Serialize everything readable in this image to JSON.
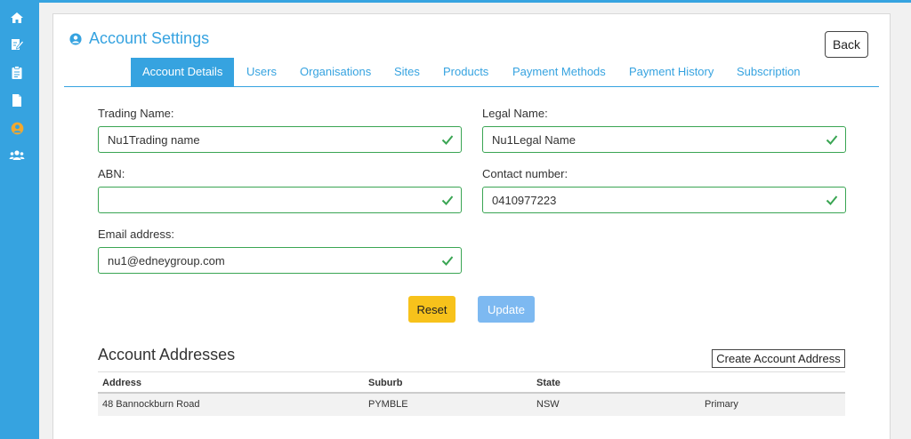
{
  "sidebar": {
    "items": [
      {
        "icon": "home-icon",
        "color": "#ffffff"
      },
      {
        "icon": "edit-document-icon",
        "color": "#ffffff"
      },
      {
        "icon": "clipboard-icon",
        "color": "#ffffff"
      },
      {
        "icon": "file-icon",
        "color": "#ffffff"
      },
      {
        "icon": "user-circle-icon",
        "color": "#f0a830",
        "active": true
      },
      {
        "icon": "users-icon",
        "color": "#ffffff"
      }
    ]
  },
  "header": {
    "title": "Account Settings",
    "back_label": "Back"
  },
  "tabs": [
    {
      "label": "Account Details",
      "active": true
    },
    {
      "label": "Users"
    },
    {
      "label": "Organisations"
    },
    {
      "label": "Sites"
    },
    {
      "label": "Products"
    },
    {
      "label": "Payment Methods"
    },
    {
      "label": "Payment History"
    },
    {
      "label": "Subscription"
    }
  ],
  "form": {
    "trading_name": {
      "label": "Trading Name:",
      "value": "Nu1Trading name"
    },
    "legal_name": {
      "label": "Legal Name:",
      "value": "Nu1Legal Name"
    },
    "abn": {
      "label": "ABN:",
      "value": ""
    },
    "contact_number": {
      "label": "Contact number:",
      "value": "0410977223"
    },
    "email": {
      "label": "Email address:",
      "value": "nu1@edneygroup.com"
    },
    "reset_label": "Reset",
    "update_label": "Update"
  },
  "addresses": {
    "title": "Account Addresses",
    "create_label": "Create Account Address",
    "columns": [
      "Address",
      "Suburb",
      "State",
      ""
    ],
    "rows": [
      [
        "48 Bannockburn Road",
        "PYMBLE",
        "NSW",
        "Primary"
      ]
    ]
  },
  "colors": {
    "primary": "#36a3e0",
    "valid": "#3aa553",
    "warning": "#f7c21b",
    "update": "#7db9f1"
  }
}
